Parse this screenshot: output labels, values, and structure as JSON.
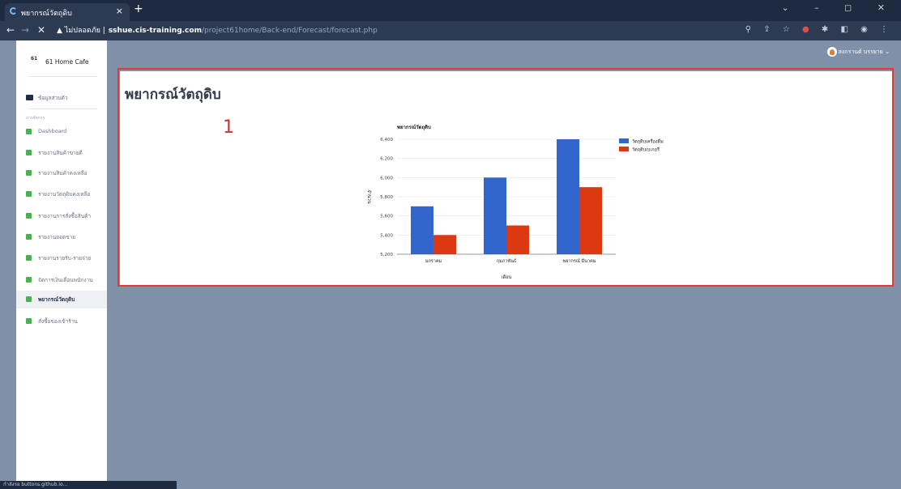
{
  "browser": {
    "tab_title": "พยากรณ์วัตถุดิบ",
    "tab_close": "×",
    "new_tab": "+",
    "url_warning": "▲ ไม่ปลอดภัย |",
    "url_host": "sshue.cis-training.com",
    "url_path": "/project61home/Back-end/Forecast/forecast.php",
    "status_text": "กำลังรอ buttons.github.io..."
  },
  "sidebar": {
    "brand_logo": "61",
    "brand_name": "61 Home Cafe",
    "profile_label": "ข้อมูลส่วนตัว",
    "section_label": "การจัดการ",
    "items": [
      {
        "label": "Dashboard"
      },
      {
        "label": "รายงานสินค้าขายดี"
      },
      {
        "label": "รายงานสินค้าคงเหลือ"
      },
      {
        "label": "รายงานวัตถุดิบคงเหลือ"
      },
      {
        "label": "รายงานการสั่งซื้อสินค้า"
      },
      {
        "label": "รายงานยอดขาย"
      },
      {
        "label": "รายงานรายรับ-รายจ่าย"
      },
      {
        "label": "จัดการเงินเดือนพนักงาน"
      },
      {
        "label": "พยากรณ์วัตถุดิบ"
      },
      {
        "label": "สั่งซื้อของเข้าร้าน"
      }
    ]
  },
  "user": {
    "name": "สงกรานต์ บรรยาย ⌄"
  },
  "page": {
    "title": "พยากรณ์วัตถุดิบ",
    "marker": "1"
  },
  "chart_data": {
    "type": "bar",
    "title": "พยากรณ์วัตถุดิบ",
    "xlabel": "เดือน",
    "ylabel": "จำนวน",
    "categories": [
      "มกราคม",
      "กุมภาพันธ์",
      "พยากรณ์ มีนาคม"
    ],
    "series": [
      {
        "name": "วัตถุดิบเครื่องดื่ม",
        "values": [
          5700,
          6000,
          6400
        ],
        "color": "#3366cc"
      },
      {
        "name": "วัตถุดิบเบเกอรี่",
        "values": [
          5400,
          5500,
          5900
        ],
        "color": "#dc3912"
      }
    ],
    "ylim": [
      5200,
      6400
    ],
    "yticks": [
      5200,
      5400,
      5600,
      5800,
      6000,
      6200,
      6400
    ],
    "ytick_labels": [
      "5,200",
      "5,400",
      "5,600",
      "5,800",
      "6,000",
      "6,200",
      "6,400"
    ],
    "grid": true,
    "legend": "right"
  }
}
